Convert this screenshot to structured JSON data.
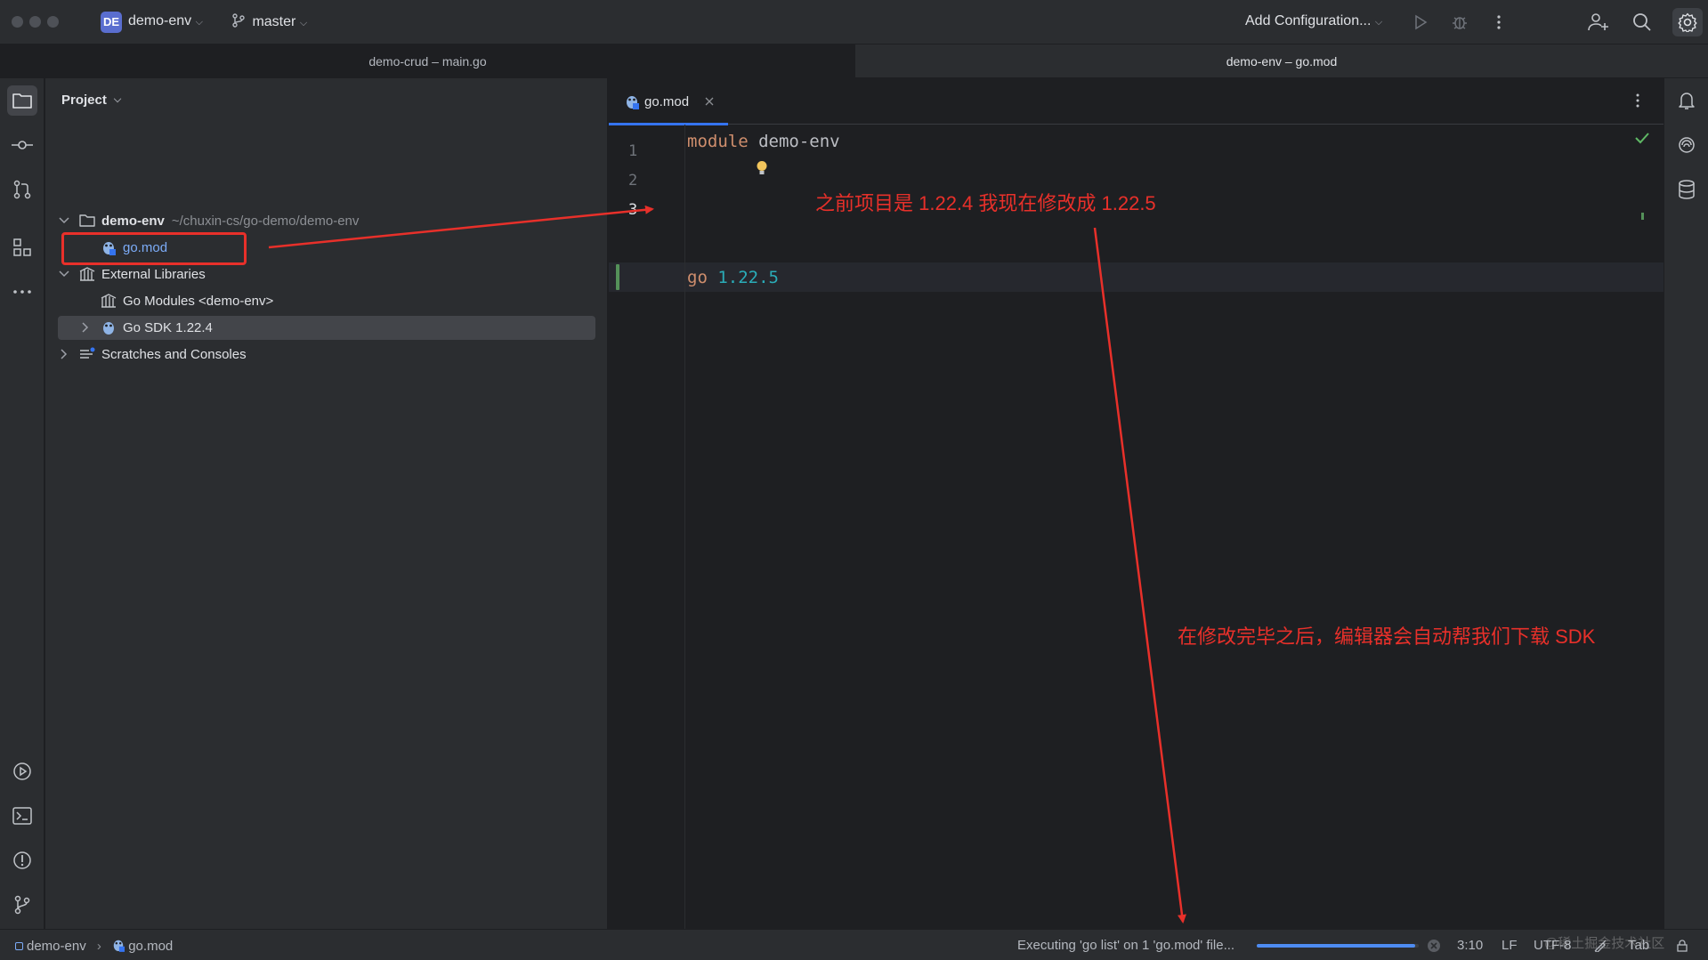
{
  "titlebar": {
    "project_badge": "DE",
    "project_name": "demo-env",
    "branch": "master",
    "run_config": "Add Configuration..."
  },
  "window_tabs": [
    {
      "label": "demo-crud – main.go"
    },
    {
      "label": "demo-env – go.mod"
    }
  ],
  "project_panel": {
    "header": "Project",
    "tree": {
      "root_label": "demo-env",
      "root_path": "~/chuxin-cs/go-demo/demo-env",
      "gomod_label": "go.mod",
      "ext_libs_label": "External Libraries",
      "go_modules_label": "Go Modules <demo-env>",
      "go_sdk_label": "Go SDK 1.22.4",
      "scratches_label": "Scratches and Consoles"
    }
  },
  "editor": {
    "tab_label": "go.mod",
    "line_numbers": [
      "1",
      "2",
      "3"
    ],
    "line1_keyword": "module",
    "line1_ident": "demo-env",
    "line3_keyword": "go",
    "line3_version": "1.22.5"
  },
  "annotations": {
    "text1": "之前项目是 1.22.4 我现在修改成 1.22.5",
    "text2": "在修改完毕之后，编辑器会自动帮我们下载 SDK",
    "color": "#e8302a"
  },
  "statusbar": {
    "project": "demo-env",
    "file": "go.mod",
    "task": "Executing 'go list' on 1 'go.mod' file...",
    "progress": 0.98,
    "position": "3:10",
    "line_sep": "LF",
    "encoding": "UTF-8",
    "indent": "Tab"
  },
  "watermark": "@稀土掘金技术社区",
  "colors": {
    "accent": "#3574f0",
    "keyword": "#cf8e6d",
    "number": "#2aacb8",
    "gomod_file": "#7cacf8"
  }
}
